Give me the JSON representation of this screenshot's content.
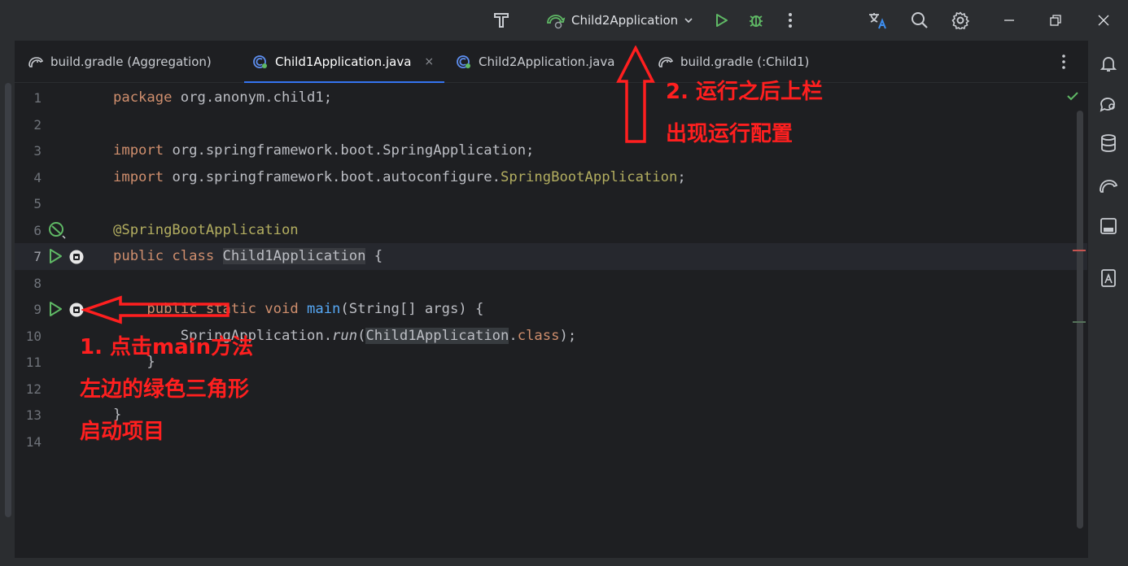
{
  "titlebar": {
    "run_config_name": "Child2Application",
    "icons": [
      "project-logo-icon",
      "run-config-icon",
      "chevron-down-icon",
      "run-icon",
      "debug-icon",
      "more-vertical-icon",
      "translate-icon",
      "search-icon",
      "settings-icon",
      "minimize-icon",
      "restore-icon",
      "close-icon"
    ]
  },
  "tabs": [
    {
      "label": "build.gradle (Aggregation)",
      "icon": "gradle-elephant-icon"
    },
    {
      "label": "Child1Application.java",
      "icon": "java-class-icon",
      "active": true
    },
    {
      "label": "Child2Application.java",
      "icon": "java-class-icon"
    },
    {
      "label": "build.gradle (:Child1)",
      "icon": "gradle-elephant-icon"
    }
  ],
  "tab_close": "×",
  "line_numbers": [
    "1",
    "2",
    "3",
    "4",
    "5",
    "6",
    "7",
    "8",
    "9",
    "10",
    "11",
    "12",
    "13",
    "14"
  ],
  "code": {
    "l1_kw": "package",
    "l1_rest": " org.anonym.child1;",
    "l3_kw": "import",
    "l3_rest": " org.springframework.boot.SpringApplication;",
    "l4_kw": "import",
    "l4_rest": " org.springframework.boot.autoconfigure.",
    "l4_ann": "SpringBootApplication",
    "l4_end": ";",
    "l6_ann": "@SpringBootApplication",
    "l7_kw": "public class ",
    "l7_cls": "Child1Application",
    "l7_end": " {",
    "l9_indent": "    ",
    "l9_kw": "public static void ",
    "l9_fn": "main",
    "l9_rest": "(String[] args) {",
    "l10_indent": "        SpringApplication.",
    "l10_fn": "run",
    "l10_open": "(",
    "l10_arg": "Child1Application",
    "l10_dot": ".",
    "l10_kw": "class",
    "l10_end": ");",
    "l11": "    }",
    "l13": "}"
  },
  "annotations": {
    "step1_line1": "1. 点击main方法",
    "step1_line2": "左边的绿色三角形",
    "step1_line3": "启动项目",
    "step2_line1": "2. 运行之后上栏",
    "step2_line2": "出现运行配置",
    "color": "#ff1f1f"
  },
  "right_toolbar_icons": [
    "notifications-icon",
    "ai-assistant-icon",
    "database-icon",
    "gradle-icon",
    "terminal-icon",
    "translation-icon"
  ],
  "colors": {
    "accent": "#3574f0",
    "run_green": "#5fb865",
    "keyword": "#cf8e6d",
    "annotation": "#b3ae60",
    "function": "#56a8f5"
  }
}
